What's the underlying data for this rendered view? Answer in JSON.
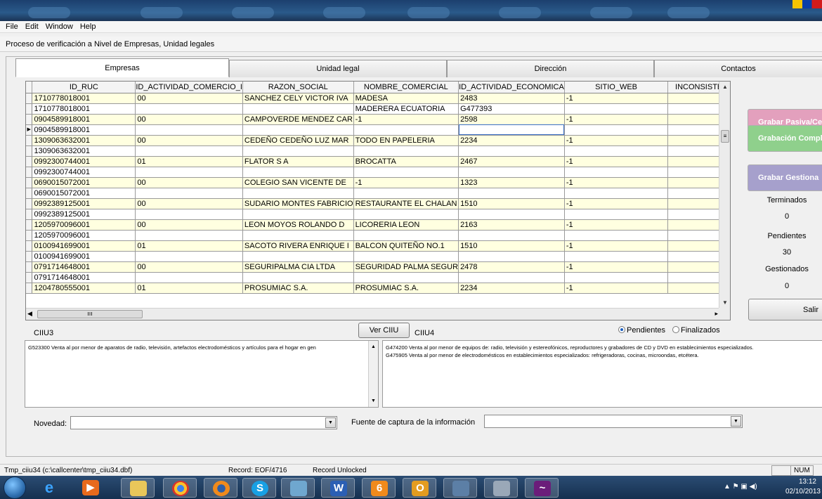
{
  "menu": [
    "File",
    "Edit",
    "Window",
    "Help"
  ],
  "window_title": "Proceso de verificación a Nivel de Empresas, Unidad legales",
  "tabs": [
    {
      "label": "Empresas"
    },
    {
      "label": "Unidad legal"
    },
    {
      "label": "Dirección"
    },
    {
      "label": "Contactos"
    }
  ],
  "grid": {
    "columns": [
      "ID_RUC",
      "ID_ACTIVIDAD_COMERCIO_I",
      "RAZON_SOCIAL",
      "NOMBRE_COMERCIAL",
      "ID_ACTIVIDAD_ECONOMICA",
      "SITIO_WEB",
      "INCONSISTE"
    ],
    "rows": [
      [
        "1710778018001",
        "00",
        "SANCHEZ CELY VICTOR IVA",
        "MADESA",
        "2483",
        "-1",
        ""
      ],
      [
        "1710778018001",
        "",
        "",
        "MADERERA ECUATORIA",
        "G477393",
        "",
        ""
      ],
      [
        "0904589918001",
        "00",
        "CAMPOVERDE MENDEZ CAR",
        "-1",
        "2598",
        "-1",
        ""
      ],
      [
        "0904589918001",
        "",
        "",
        "",
        "",
        "",
        ""
      ],
      [
        "1309063632001",
        "00",
        "CEDEÑO  CEDEÑO LUZ MAR",
        "TODO EN PAPELERIA",
        "2234",
        "-1",
        ""
      ],
      [
        "1309063632001",
        "",
        "",
        "",
        "",
        "",
        ""
      ],
      [
        "0992300744001",
        "01",
        "FLATOR S A",
        "BROCATTA",
        "2467",
        "-1",
        ""
      ],
      [
        "0992300744001",
        "",
        "",
        "",
        "",
        "",
        ""
      ],
      [
        "0690015072001",
        "00",
        "COLEGIO SAN VICENTE DE",
        "-1",
        "1323",
        "-1",
        ""
      ],
      [
        "0690015072001",
        "",
        "",
        "",
        "",
        "",
        ""
      ],
      [
        "0992389125001",
        "00",
        "SUDARIO MONTES FABRICIO",
        "RESTAURANTE EL CHALAN",
        "1510",
        "-1",
        ""
      ],
      [
        "0992389125001",
        "",
        "",
        "",
        "",
        "",
        ""
      ],
      [
        "1205970096001",
        "00",
        "LEON  MOYOS ROLANDO  D",
        "LICORERIA LEON",
        "2163",
        "-1",
        ""
      ],
      [
        "1205970096001",
        "",
        "",
        "",
        "",
        "",
        ""
      ],
      [
        "0100941699001",
        "01",
        "SACOTO RIVERA ENRIQUE I",
        "BALCON QUITEÑO NO.1",
        "1510",
        "-1",
        ""
      ],
      [
        "0100941699001",
        "",
        "",
        "",
        "",
        "",
        ""
      ],
      [
        "0791714648001",
        "00",
        " SEGURIPALMA CIA LTDA",
        "SEGURIDAD PALMA SEGUR",
        "2478",
        "-1",
        ""
      ],
      [
        "0791714648001",
        "",
        "",
        "",
        "",
        "",
        ""
      ],
      [
        "1204780555001",
        "01",
        "PROSUMIAC S.A.",
        "PROSUMIAC S.A.",
        "2234",
        "-1",
        ""
      ]
    ]
  },
  "side": {
    "btn_pasiva": "Grabar Pasiva/Cer",
    "btn_completa": "Grabación Comple",
    "btn_gestion": "Grabar Gestiona",
    "terminados_label": "Terminados",
    "terminados_value": "0",
    "pendientes_label": "Pendientes",
    "pendientes_value": "30",
    "gestionados_label": "Gestionados",
    "gestionados_value": "0",
    "salir": "Salir"
  },
  "colors": {
    "pasiva": "#e3a0bd",
    "completa": "#8fd08c",
    "gestion": "#a6a0cc"
  },
  "ciiu": {
    "ciiu3_label": "CIIU3",
    "ver_button": "Ver CIIU",
    "ciiu4_label": "CIIU4",
    "radio_pendientes": "Pendientes",
    "radio_finalizados": "Finalizados",
    "ciiu3_text": "G523300   Venta al por menor de aparatos de radio, televisión,  artefactos electrodomésticos y artículos para el hogar en gen",
    "ciiu4_lines": [
      "G474200   Venta al por menor de equipos de: radio, televisión y estereofónicos, reproductores y grabadores de CD y DVD en establecimientos especializados.",
      "G475905   Venta al por menor de electrodomésticos en establecimientos especializados: refrigeradoras, cocinas, microondas, etcétera."
    ]
  },
  "form": {
    "novedad_label": "Novedad:",
    "fuente_label": "Fuente de captura de la información"
  },
  "status": {
    "table": "Tmp_ciiu34 (c:\\callcenter\\tmp_ciiu34.dbf)",
    "record": "Record: EOF/4716",
    "lock": "Record Unlocked",
    "num": "NUM"
  },
  "taskbar": {
    "time": "13:12",
    "date": "02/10/2013",
    "apps": [
      "internet-explorer-icon",
      "media-player-icon",
      "file-explorer-icon",
      "chrome-icon",
      "firefox-icon",
      "skype-icon",
      "virtualbox-icon",
      "word-icon",
      "foxpro-icon",
      "outlook-icon",
      "network-icon",
      "calculator-icon",
      "stock-chart-icon"
    ]
  }
}
